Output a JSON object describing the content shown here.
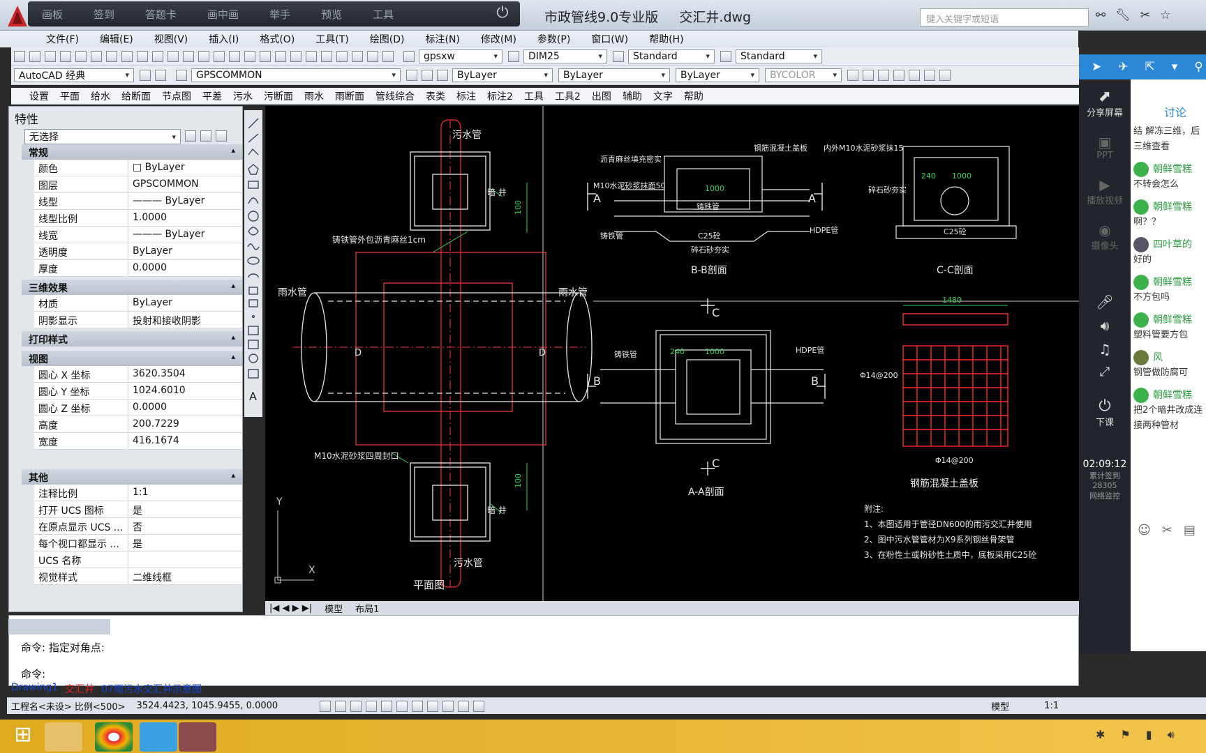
{
  "title_tabs": [
    "画板",
    "签到",
    "答题卡",
    "画中画",
    "举手",
    "预览",
    "工具"
  ],
  "app_title": "市政管线9.0专业版",
  "file_name": "交汇井.dwg",
  "search_placeholder": "键入关键字或短语",
  "menus": [
    "文件(F)",
    "编辑(E)",
    "视图(V)",
    "插入(I)",
    "格式(O)",
    "工具(T)",
    "绘图(D)",
    "标注(N)",
    "修改(M)",
    "参数(P)",
    "窗口(W)",
    "帮助(H)"
  ],
  "toolbar1": {
    "layer_select": "gpsxw",
    "dim_select": "DIM25",
    "text_style": "Standard",
    "table_style": "Standard"
  },
  "toolbar2": {
    "workspace": "AutoCAD 经典",
    "layer": "GPSCOMMON",
    "color": "ByLayer",
    "linetype": "ByLayer",
    "lineweight": "ByLayer",
    "plot": "BYCOLOR"
  },
  "ribbon": [
    "设置",
    "平面",
    "给水",
    "给断面",
    "节点图",
    "平差",
    "污水",
    "污断面",
    "雨水",
    "雨断面",
    "管线综合",
    "表类",
    "标注",
    "标注2",
    "工具",
    "工具2",
    "出图",
    "辅助",
    "文字",
    "帮助"
  ],
  "properties": {
    "title": "特性",
    "selection": "无选择",
    "sections": [
      {
        "name": "常规",
        "rows": [
          [
            "颜色",
            "□ ByLayer"
          ],
          [
            "图层",
            "GPSCOMMON"
          ],
          [
            "线型",
            "——— ByLayer"
          ],
          [
            "线型比例",
            "1.0000"
          ],
          [
            "线宽",
            "——— ByLayer"
          ],
          [
            "透明度",
            "ByLayer"
          ],
          [
            "厚度",
            "0.0000"
          ]
        ]
      },
      {
        "name": "三维效果",
        "rows": [
          [
            "材质",
            "ByLayer"
          ],
          [
            "阴影显示",
            "投射和接收阴影"
          ]
        ]
      },
      {
        "name": "打印样式",
        "rows": []
      },
      {
        "name": "视图",
        "rows": [
          [
            "圆心 X 坐标",
            "3620.3504"
          ],
          [
            "圆心 Y 坐标",
            "1024.6010"
          ],
          [
            "圆心 Z 坐标",
            "0.0000"
          ],
          [
            "高度",
            "200.7229"
          ],
          [
            "宽度",
            "416.1674"
          ]
        ]
      },
      {
        "name": "其他",
        "rows": [
          [
            "注释比例",
            "1:1"
          ],
          [
            "打开 UCS 图标",
            "是"
          ],
          [
            "在原点显示 UCS ...",
            "否"
          ],
          [
            "每个视口都显示 ...",
            "是"
          ],
          [
            "UCS 名称",
            ""
          ],
          [
            "视觉样式",
            "二维线框"
          ]
        ]
      }
    ]
  },
  "drawing": {
    "sewer_top": "污水管",
    "sewer_bottom": "污水管",
    "well_top": "暗 井",
    "well_bottom": "暗 井",
    "cast_iron": "铸铁管外包沥青麻丝1cm",
    "rain_left": "雨水管",
    "rain_right": "雨水管",
    "seal": "M10水泥砂浆四周封口",
    "plan": "平面图",
    "dim100a": "100",
    "dim100b": "100",
    "bb": "B-B剖面",
    "cc": "C-C剖面",
    "aa": "A-A剖面",
    "cover": "钢筋混凝土盖板",
    "note_title": "附注:",
    "notes": [
      "1、本图适用于管径DN600的雨污交汇井使用",
      "2、图中污水管管材为X9系列钢丝骨架管",
      "3、在粉性土或粉砂性土质中，底板采用C25砼"
    ],
    "labels": {
      "asphalt": "沥青麻丝填充密实",
      "mortar": "M10水泥砂浆抹面50",
      "rc_cover": "钢筋混凝土盖板",
      "inner": "内外M10水泥砂浆抹15",
      "cast": "铸铁管",
      "hdpe": "HDPE管",
      "gravel": "碎石砂夯实",
      "c25": "C25砼",
      "dim1000": "1000",
      "dim240": "240",
      "dim1480": "1480",
      "rebar": "Φ14@200",
      "A": "A",
      "B": "B",
      "C": "C",
      "D": "D"
    }
  },
  "layout_tabs": [
    "模型",
    "布局1"
  ],
  "command": {
    "line1": "命令: 指定对角点:",
    "line2": "命令:"
  },
  "file_tabs": [
    "Drawing1",
    "交汇井",
    "07雨污水交汇井示意图"
  ],
  "status": {
    "project": "工程名<未设> 比例<500>",
    "coords": "3524.4423, 1045.9455, 0.0000",
    "model": "模型",
    "scale": "1:1"
  },
  "side": {
    "share": "分享屏幕",
    "ppt": "PPT",
    "video": "播放视频",
    "camera": "摄像头",
    "end": "下课",
    "time": "02:09:12",
    "count_label": "累计签到",
    "count": "28305",
    "net": "网络监控"
  },
  "chat": {
    "tab": "讨论",
    "messages": [
      {
        "name": "",
        "text": "结 解冻三维，后三维查看"
      },
      {
        "name": "朝鲜雪糕",
        "text": "不转会怎么"
      },
      {
        "name": "朝鲜雪糕",
        "text": "啊？？"
      },
      {
        "name": "四叶草的",
        "text": "好的"
      },
      {
        "name": "朝鲜雪糕",
        "text": "不方包吗"
      },
      {
        "name": "朝鲜雪糕",
        "text": "塑料管要方包"
      },
      {
        "name": "风",
        "text": "钢管做防腐可"
      },
      {
        "name": "朝鲜雪糕",
        "text": "把2个暗井改成连接两种管材"
      }
    ]
  }
}
